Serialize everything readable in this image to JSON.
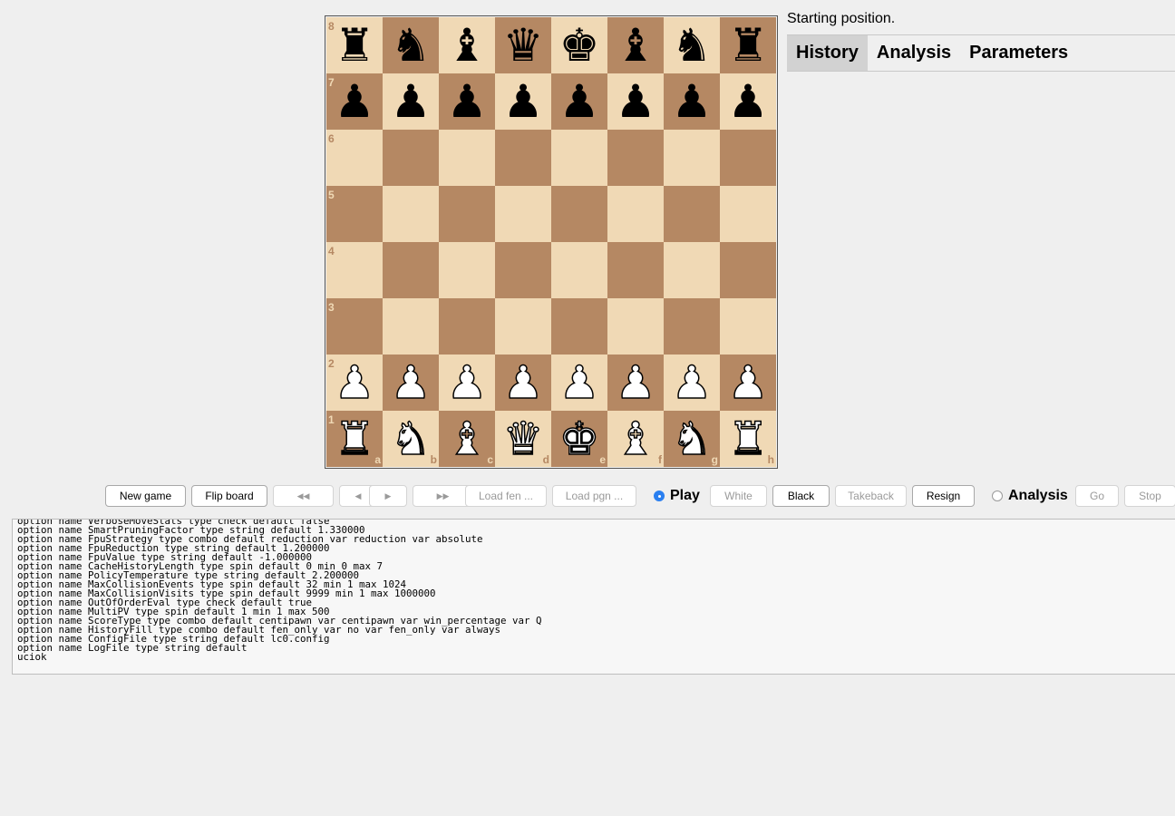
{
  "status_text": "Starting position.",
  "tabs": [
    {
      "label": "History",
      "active": true
    },
    {
      "label": "Analysis",
      "active": false
    },
    {
      "label": "Parameters",
      "active": false
    }
  ],
  "board": {
    "position": [
      [
        "r",
        "n",
        "b",
        "q",
        "k",
        "b",
        "n",
        "r"
      ],
      [
        "p",
        "p",
        "p",
        "p",
        "p",
        "p",
        "p",
        "p"
      ],
      [
        "",
        "",
        "",
        "",
        "",
        "",
        "",
        ""
      ],
      [
        "",
        "",
        "",
        "",
        "",
        "",
        "",
        ""
      ],
      [
        "",
        "",
        "",
        "",
        "",
        "",
        "",
        ""
      ],
      [
        "",
        "",
        "",
        "",
        "",
        "",
        "",
        ""
      ],
      [
        "P",
        "P",
        "P",
        "P",
        "P",
        "P",
        "P",
        "P"
      ],
      [
        "R",
        "N",
        "B",
        "Q",
        "K",
        "B",
        "N",
        "R"
      ]
    ],
    "rank_labels": [
      "8",
      "7",
      "6",
      "5",
      "4",
      "3",
      "2",
      "1"
    ],
    "file_labels": [
      "a",
      "b",
      "c",
      "d",
      "e",
      "f",
      "g",
      "h"
    ],
    "light_color": "#f0d9b5",
    "dark_color": "#b58863"
  },
  "controls": {
    "new_game": "New game",
    "flip_board": "Flip board",
    "first": "◀◀",
    "prev": "◀",
    "next": "▶",
    "last": "▶▶",
    "load_fen": "Load fen ...",
    "load_pgn": "Load pgn ...",
    "play_label": "Play",
    "play_checked": true,
    "white": "White",
    "black": "Black",
    "takeback": "Takeback",
    "resign": "Resign",
    "analysis_label": "Analysis",
    "analysis_checked": false,
    "go": "Go",
    "stop": "Stop"
  },
  "log": {
    "lines": [
      "option name VerboseMoveStats type check default false",
      "option name SmartPruningFactor type string default 1.330000",
      "option name FpuStrategy type combo default reduction var reduction var absolute",
      "option name FpuReduction type string default 1.200000",
      "option name FpuValue type string default -1.000000",
      "option name CacheHistoryLength type spin default 0 min 0 max 7",
      "option name PolicyTemperature type string default 2.200000",
      "option name MaxCollisionEvents type spin default 32 min 1 max 1024",
      "option name MaxCollisionVisits type spin default 9999 min 1 max 1000000",
      "option name OutOfOrderEval type check default true",
      "option name MultiPV type spin default 1 min 1 max 500",
      "option name ScoreType type combo default centipawn var centipawn var win_percentage var Q",
      "option name HistoryFill type combo default fen_only var no var fen_only var always",
      "option name ConfigFile type string default lc0.config",
      "option name LogFile type string default",
      "uciok"
    ]
  }
}
